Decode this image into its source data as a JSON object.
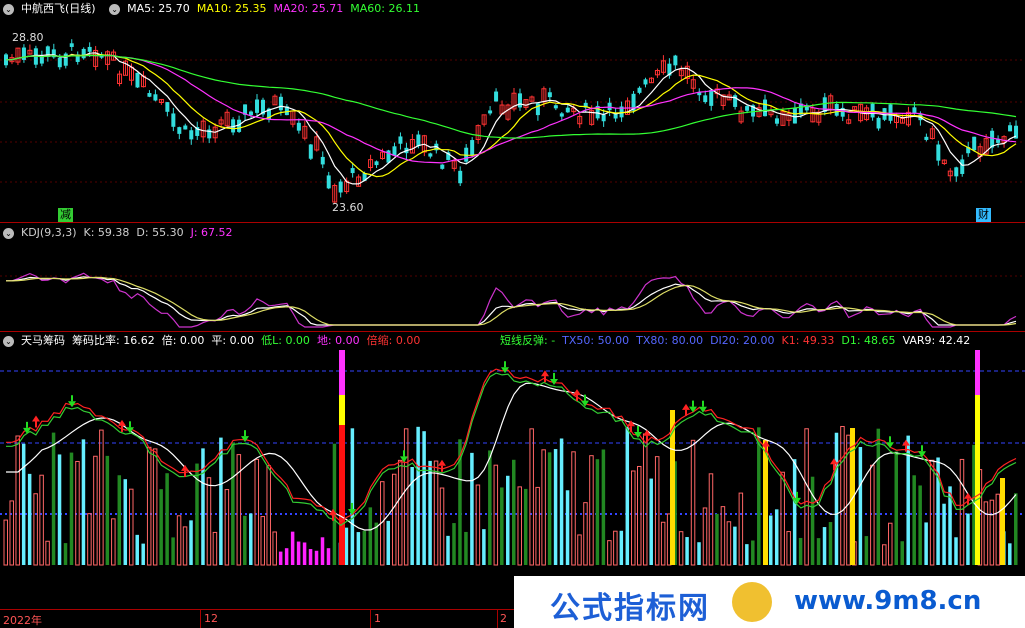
{
  "price_panel": {
    "stock_name": "中航西飞(日线)",
    "ma5": "MA5: 25.70",
    "ma10": "MA10: 25.35",
    "ma20": "MA20: 25.71",
    "ma60": "MA60: 26.11",
    "high_label": "28.80",
    "low_label": "23.60",
    "mark_left": "减",
    "mark_right": "财"
  },
  "kdj_panel": {
    "name": "KDJ(9,3,3)",
    "k": "K: 59.38",
    "d": "D: 55.30",
    "j": "J: 67.52"
  },
  "chip_panel": {
    "name": "天马筹码",
    "ratio": "筹码比率: 16.62",
    "bei": "倍: 0.00",
    "ping": "平: 0.00",
    "di_l": "低L: 0.00",
    "di": "地: 0.00",
    "bei_suo": "倍缩: 0.00",
    "short_rebound": "短线反弹: -",
    "tx50": "TX50: 50.00",
    "tx80": "TX80: 80.00",
    "di20": "DI20: 20.00",
    "k1": "K1: 49.33",
    "d1": "D1: 48.65",
    "var9": "VAR9: 42.42"
  },
  "time_axis": {
    "labels": [
      "2022年",
      "12",
      "1",
      "2"
    ]
  },
  "watermark": {
    "text": "公式指标网",
    "url": "www.9m8.cn"
  },
  "colors": {
    "background": "#000000",
    "divider": "#aa0000",
    "up": "#ff3333",
    "down": "#33dddd",
    "ma5": "#ffffff",
    "ma10": "#ffff00",
    "ma20": "#ff33ff",
    "ma60": "#33ff33",
    "tx_line": "#3344ff"
  }
}
